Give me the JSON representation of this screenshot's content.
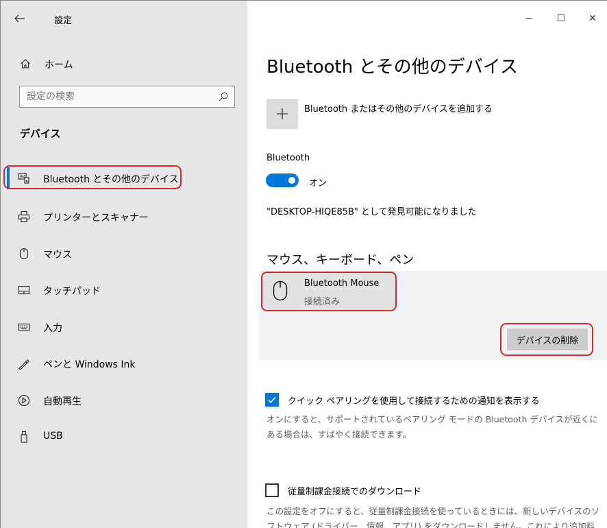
{
  "window": {
    "title": "設定",
    "minimize_glyph": "−",
    "maximize_glyph": "☐",
    "close_glyph": "✕"
  },
  "sidebar": {
    "home_label": "ホーム",
    "search_placeholder": "設定の検索",
    "section_title": "デバイス",
    "items": [
      {
        "label": "Bluetooth とその他のデバイス",
        "icon": "bluetooth-devices-icon",
        "active": true
      },
      {
        "label": "プリンターとスキャナー",
        "icon": "printer-icon"
      },
      {
        "label": "マウス",
        "icon": "mouse-icon"
      },
      {
        "label": "タッチパッド",
        "icon": "touchpad-icon"
      },
      {
        "label": "入力",
        "icon": "keyboard-icon"
      },
      {
        "label": "ペンと Windows Ink",
        "icon": "pen-icon"
      },
      {
        "label": "自動再生",
        "icon": "autoplay-icon"
      },
      {
        "label": "USB",
        "icon": "usb-icon"
      }
    ]
  },
  "main": {
    "page_title": "Bluetooth とその他のデバイス",
    "add_device_label": "Bluetooth またはその他のデバイスを追加する",
    "bluetooth_label": "Bluetooth",
    "bluetooth_state": "オン",
    "bluetooth_on": true,
    "discoverable_text": "\"DESKTOP-HIQE85B\" として発見可能になりました",
    "group_title": "マウス、キーボード、ペン",
    "device": {
      "name": "Bluetooth Mouse",
      "status": "接続済み",
      "remove_label": "デバイスの削除"
    },
    "swift_pair": {
      "label": "クイック ペアリングを使用して接続するための通知を表示する",
      "checked": true,
      "description": "オンにすると、サポートされているペアリング モードの Bluetooth デバイスが近くにある場合は、すばやく接続できます。"
    },
    "metered": {
      "label": "従量制課金接続でのダウンロード",
      "checked": false,
      "description": "この設定をオフにすると、従量制課金接続を使っているときには、新しいデバイスのソフトウェア (ドライバー、情報、アプリ) をダウンロードしません。これにより追加料金"
    }
  },
  "colors": {
    "accent": "#0078d7",
    "sidebar_bg": "#e6e6e6",
    "annotation": "#d42a2a"
  }
}
